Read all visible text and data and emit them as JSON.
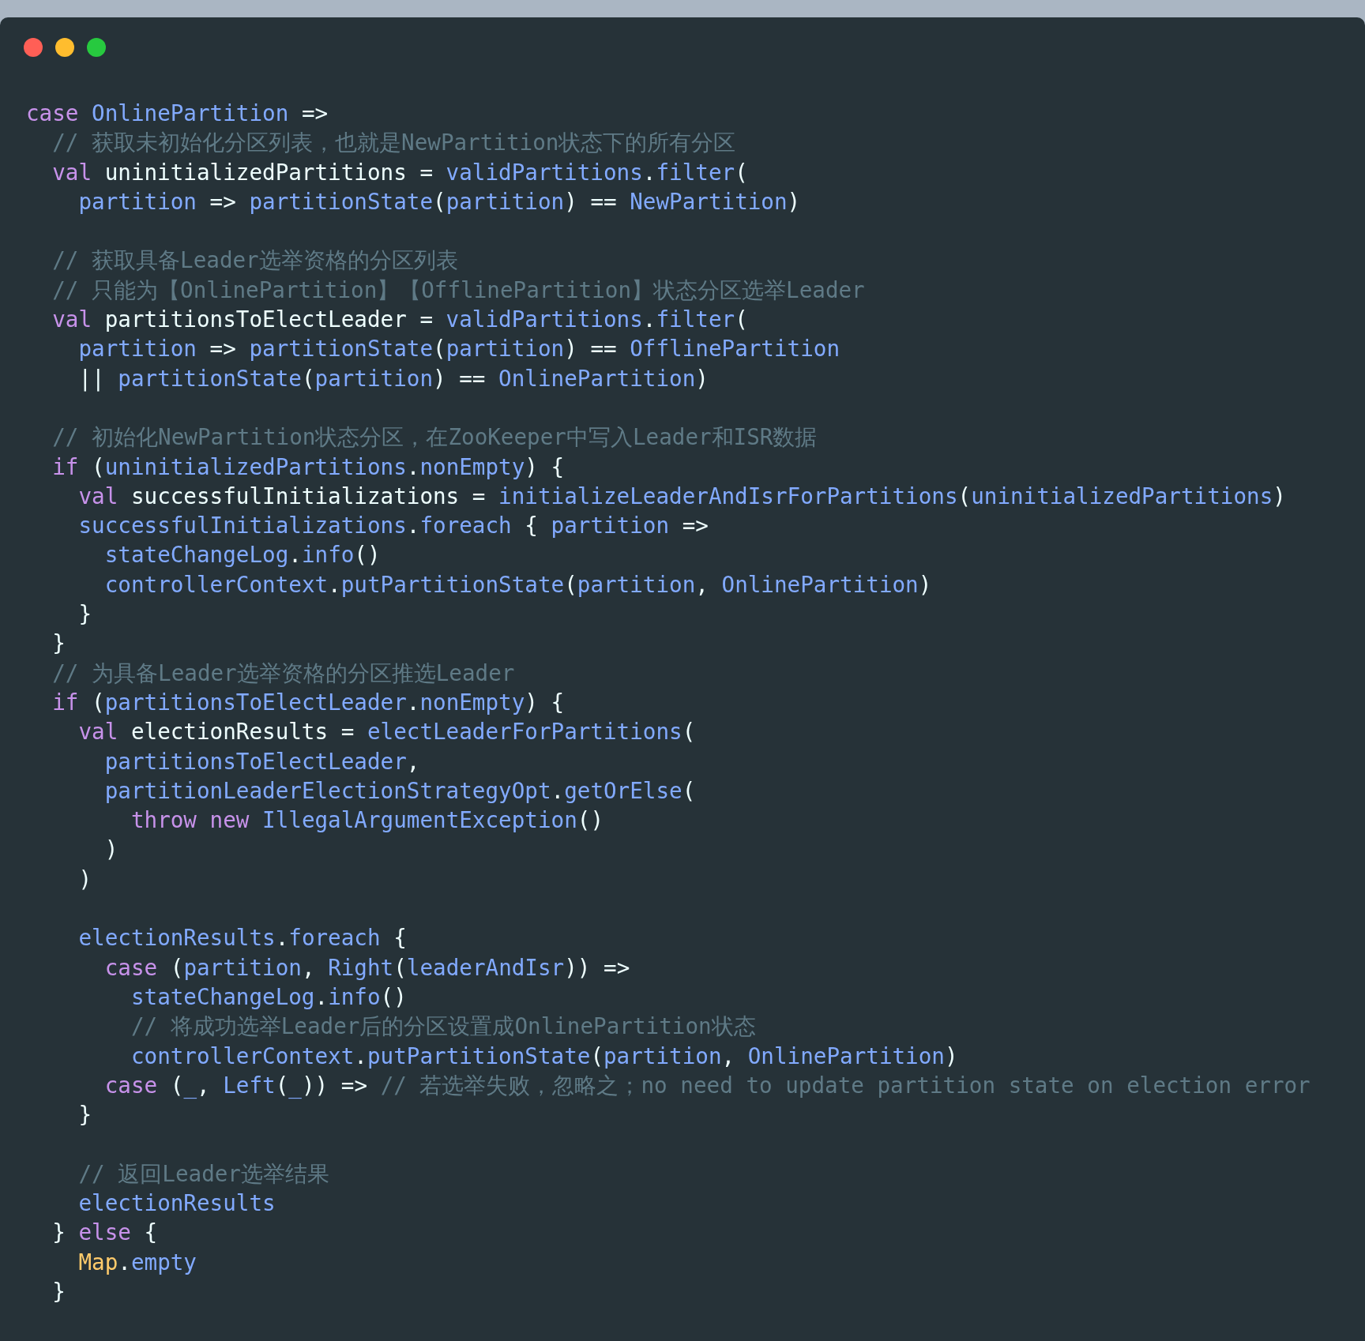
{
  "window": {
    "controls": [
      {
        "color": "#ff5f56"
      },
      {
        "color": "#ffbd2e"
      },
      {
        "color": "#27c93f"
      }
    ]
  },
  "code_lines": [
    {
      "kind": "code",
      "tokens": [
        {
          "kind": "keyword",
          "text": "case "
        },
        {
          "kind": "ident",
          "text": "OnlinePartition"
        },
        {
          "kind": "plain",
          "text": " =>"
        }
      ]
    },
    {
      "kind": "code",
      "tokens": [
        {
          "kind": "comment",
          "text": "  // 获取未初始化分区列表，也就是NewPartition状态下的所有分区"
        }
      ]
    },
    {
      "kind": "code",
      "tokens": [
        {
          "kind": "keyword",
          "text": "  val "
        },
        {
          "kind": "plain",
          "text": "uninitializedPartitions = "
        },
        {
          "kind": "ident",
          "text": "validPartitions"
        },
        {
          "kind": "member",
          "text": ".filter"
        },
        {
          "kind": "plain",
          "text": "("
        }
      ]
    },
    {
      "kind": "code",
      "tokens": [
        {
          "kind": "ident",
          "text": "    partition"
        },
        {
          "kind": "plain",
          "text": " => "
        },
        {
          "kind": "ident",
          "text": "partitionState"
        },
        {
          "kind": "plain",
          "text": "("
        },
        {
          "kind": "ident",
          "text": "partition"
        },
        {
          "kind": "plain",
          "text": ") == "
        },
        {
          "kind": "ident",
          "text": "NewPartition"
        },
        {
          "kind": "plain",
          "text": ")"
        }
      ]
    },
    {
      "kind": "blank"
    },
    {
      "kind": "code",
      "tokens": [
        {
          "kind": "comment",
          "text": "  // 获取具备Leader选举资格的分区列表"
        }
      ]
    },
    {
      "kind": "code",
      "tokens": [
        {
          "kind": "comment",
          "text": "  // 只能为【OnlinePartition】【OfflinePartition】状态分区选举Leader"
        }
      ]
    },
    {
      "kind": "code",
      "tokens": [
        {
          "kind": "keyword",
          "text": "  val "
        },
        {
          "kind": "plain",
          "text": "partitionsToElectLeader = "
        },
        {
          "kind": "ident",
          "text": "validPartitions"
        },
        {
          "kind": "member",
          "text": ".filter"
        },
        {
          "kind": "plain",
          "text": "("
        }
      ]
    },
    {
      "kind": "code",
      "tokens": [
        {
          "kind": "ident",
          "text": "    partition"
        },
        {
          "kind": "plain",
          "text": " => "
        },
        {
          "kind": "ident",
          "text": "partitionState"
        },
        {
          "kind": "plain",
          "text": "("
        },
        {
          "kind": "ident",
          "text": "partition"
        },
        {
          "kind": "plain",
          "text": ") == "
        },
        {
          "kind": "ident",
          "text": "OfflinePartition"
        }
      ]
    },
    {
      "kind": "code",
      "tokens": [
        {
          "kind": "plain",
          "text": "    || "
        },
        {
          "kind": "ident",
          "text": "partitionState"
        },
        {
          "kind": "plain",
          "text": "("
        },
        {
          "kind": "ident",
          "text": "partition"
        },
        {
          "kind": "plain",
          "text": ") == "
        },
        {
          "kind": "ident",
          "text": "OnlinePartition"
        },
        {
          "kind": "plain",
          "text": ")"
        }
      ]
    },
    {
      "kind": "blank"
    },
    {
      "kind": "code",
      "tokens": [
        {
          "kind": "comment",
          "text": "  // 初始化NewPartition状态分区，在ZooKeeper中写入Leader和ISR数据"
        }
      ]
    },
    {
      "kind": "code",
      "tokens": [
        {
          "kind": "keyword",
          "text": "  if"
        },
        {
          "kind": "plain",
          "text": " ("
        },
        {
          "kind": "ident",
          "text": "uninitializedPartitions"
        },
        {
          "kind": "member",
          "text": ".nonEmpty"
        },
        {
          "kind": "plain",
          "text": ") {"
        }
      ]
    },
    {
      "kind": "code",
      "tokens": [
        {
          "kind": "keyword",
          "text": "    val "
        },
        {
          "kind": "plain",
          "text": "successfulInitializations = "
        },
        {
          "kind": "ident",
          "text": "initializeLeaderAndIsrForPartitions"
        },
        {
          "kind": "plain",
          "text": "("
        },
        {
          "kind": "ident",
          "text": "uninitializedPartitions"
        },
        {
          "kind": "plain",
          "text": ")"
        }
      ]
    },
    {
      "kind": "code",
      "tokens": [
        {
          "kind": "ident",
          "text": "    successfulInitializations"
        },
        {
          "kind": "member",
          "text": ".foreach"
        },
        {
          "kind": "plain",
          "text": " { "
        },
        {
          "kind": "ident",
          "text": "partition"
        },
        {
          "kind": "plain",
          "text": " =>"
        }
      ]
    },
    {
      "kind": "code",
      "tokens": [
        {
          "kind": "ident",
          "text": "      stateChangeLog"
        },
        {
          "kind": "member",
          "text": ".info"
        },
        {
          "kind": "plain",
          "text": "()"
        }
      ]
    },
    {
      "kind": "code",
      "tokens": [
        {
          "kind": "ident",
          "text": "      controllerContext"
        },
        {
          "kind": "member",
          "text": ".putPartitionState"
        },
        {
          "kind": "plain",
          "text": "("
        },
        {
          "kind": "ident",
          "text": "partition"
        },
        {
          "kind": "plain",
          "text": ", "
        },
        {
          "kind": "ident",
          "text": "OnlinePartition"
        },
        {
          "kind": "plain",
          "text": ")"
        }
      ]
    },
    {
      "kind": "code",
      "tokens": [
        {
          "kind": "plain",
          "text": "    }"
        }
      ]
    },
    {
      "kind": "code",
      "tokens": [
        {
          "kind": "plain",
          "text": "  }"
        }
      ]
    },
    {
      "kind": "code",
      "tokens": [
        {
          "kind": "comment",
          "text": "  // 为具备Leader选举资格的分区推选Leader"
        }
      ]
    },
    {
      "kind": "code",
      "tokens": [
        {
          "kind": "keyword",
          "text": "  if"
        },
        {
          "kind": "plain",
          "text": " ("
        },
        {
          "kind": "ident",
          "text": "partitionsToElectLeader"
        },
        {
          "kind": "member",
          "text": ".nonEmpty"
        },
        {
          "kind": "plain",
          "text": ") {"
        }
      ]
    },
    {
      "kind": "code",
      "tokens": [
        {
          "kind": "keyword",
          "text": "    val "
        },
        {
          "kind": "plain",
          "text": "electionResults = "
        },
        {
          "kind": "ident",
          "text": "electLeaderForPartitions"
        },
        {
          "kind": "plain",
          "text": "("
        }
      ]
    },
    {
      "kind": "code",
      "tokens": [
        {
          "kind": "ident",
          "text": "      partitionsToElectLeader"
        },
        {
          "kind": "plain",
          "text": ","
        }
      ]
    },
    {
      "kind": "code",
      "tokens": [
        {
          "kind": "ident",
          "text": "      partitionLeaderElectionStrategyOpt"
        },
        {
          "kind": "member",
          "text": ".getOrElse"
        },
        {
          "kind": "plain",
          "text": "("
        }
      ]
    },
    {
      "kind": "code",
      "tokens": [
        {
          "kind": "keyword",
          "text": "        throw new "
        },
        {
          "kind": "ident",
          "text": "IllegalArgumentException"
        },
        {
          "kind": "plain",
          "text": "()"
        }
      ]
    },
    {
      "kind": "code",
      "tokens": [
        {
          "kind": "plain",
          "text": "      )"
        }
      ]
    },
    {
      "kind": "code",
      "tokens": [
        {
          "kind": "plain",
          "text": "    )"
        }
      ]
    },
    {
      "kind": "blank"
    },
    {
      "kind": "code",
      "tokens": [
        {
          "kind": "ident",
          "text": "    electionResults"
        },
        {
          "kind": "member",
          "text": ".foreach"
        },
        {
          "kind": "plain",
          "text": " {"
        }
      ]
    },
    {
      "kind": "code",
      "tokens": [
        {
          "kind": "keyword",
          "text": "      case "
        },
        {
          "kind": "plain",
          "text": "("
        },
        {
          "kind": "ident",
          "text": "partition"
        },
        {
          "kind": "plain",
          "text": ", "
        },
        {
          "kind": "ident",
          "text": "Right"
        },
        {
          "kind": "plain",
          "text": "("
        },
        {
          "kind": "ident",
          "text": "leaderAndIsr"
        },
        {
          "kind": "plain",
          "text": ")) =>"
        }
      ]
    },
    {
      "kind": "code",
      "tokens": [
        {
          "kind": "ident",
          "text": "        stateChangeLog"
        },
        {
          "kind": "member",
          "text": ".info"
        },
        {
          "kind": "plain",
          "text": "()"
        }
      ]
    },
    {
      "kind": "code",
      "tokens": [
        {
          "kind": "comment",
          "text": "        // 将成功选举Leader后的分区设置成OnlinePartition状态"
        }
      ]
    },
    {
      "kind": "code",
      "tokens": [
        {
          "kind": "ident",
          "text": "        controllerContext"
        },
        {
          "kind": "member",
          "text": ".putPartitionState"
        },
        {
          "kind": "plain",
          "text": "("
        },
        {
          "kind": "ident",
          "text": "partition"
        },
        {
          "kind": "plain",
          "text": ", "
        },
        {
          "kind": "ident",
          "text": "OnlinePartition"
        },
        {
          "kind": "plain",
          "text": ")"
        }
      ]
    },
    {
      "kind": "code",
      "tokens": [
        {
          "kind": "keyword",
          "text": "      case "
        },
        {
          "kind": "plain",
          "text": "("
        },
        {
          "kind": "ident",
          "text": "_"
        },
        {
          "kind": "plain",
          "text": ", "
        },
        {
          "kind": "ident",
          "text": "Left"
        },
        {
          "kind": "plain",
          "text": "("
        },
        {
          "kind": "ident",
          "text": "_"
        },
        {
          "kind": "plain",
          "text": ")) => "
        },
        {
          "kind": "comment",
          "text": "// 若选举失败，忽略之；no need to update partition state on election error"
        }
      ]
    },
    {
      "kind": "code",
      "tokens": [
        {
          "kind": "plain",
          "text": "    }"
        }
      ]
    },
    {
      "kind": "blank"
    },
    {
      "kind": "code",
      "tokens": [
        {
          "kind": "comment",
          "text": "    // 返回Leader选举结果"
        }
      ]
    },
    {
      "kind": "code",
      "tokens": [
        {
          "kind": "ident",
          "text": "    electionResults"
        }
      ]
    },
    {
      "kind": "code",
      "tokens": [
        {
          "kind": "plain",
          "text": "  } "
        },
        {
          "kind": "keyword",
          "text": "else"
        },
        {
          "kind": "plain",
          "text": " {"
        }
      ]
    },
    {
      "kind": "code",
      "tokens": [
        {
          "kind": "type",
          "text": "    Map"
        },
        {
          "kind": "member",
          "text": ".empty"
        }
      ]
    },
    {
      "kind": "code",
      "tokens": [
        {
          "kind": "plain",
          "text": "  }"
        }
      ]
    }
  ]
}
